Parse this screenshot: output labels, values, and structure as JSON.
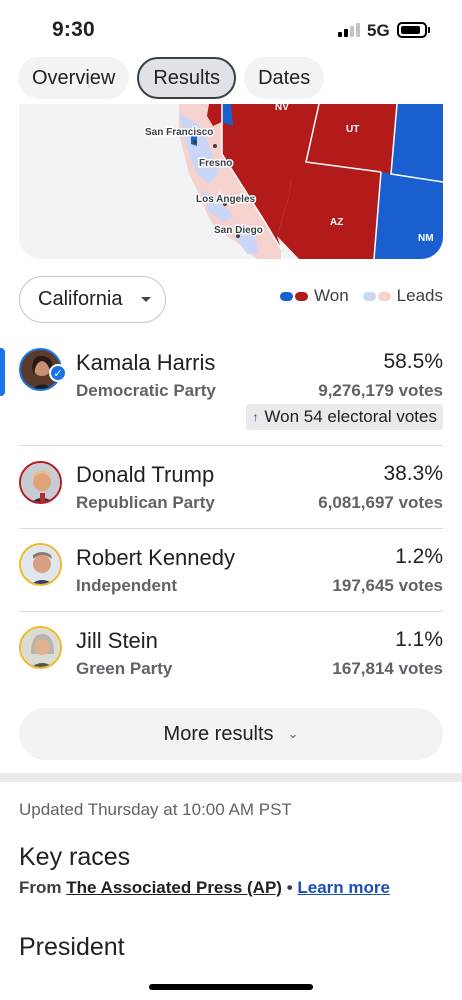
{
  "status": {
    "time": "9:30",
    "network": "5G"
  },
  "tabs": [
    {
      "label": "Overview",
      "active": false
    },
    {
      "label": "Results",
      "active": true
    },
    {
      "label": "Dates",
      "active": false
    }
  ],
  "map": {
    "cities": [
      "San Francisco",
      "Fresno",
      "Los Angeles",
      "San Diego"
    ],
    "states": [
      "NV",
      "UT",
      "AZ",
      "NM"
    ]
  },
  "selector": {
    "state": "California"
  },
  "legend": {
    "won": "Won",
    "leads": "Leads"
  },
  "colors": {
    "dem": "#1a5fd0",
    "rep": "#b31b1b",
    "dem_light": "#cbd6f7",
    "rep_light": "#f6d2cf",
    "accent": "#1a73e8"
  },
  "candidates": [
    {
      "name": "Kamala Harris",
      "party": "Democratic Party",
      "pct": "58.5%",
      "votes": "9,276,179 votes",
      "badge": "Won 54 electoral votes",
      "winner": true
    },
    {
      "name": "Donald Trump",
      "party": "Republican Party",
      "pct": "38.3%",
      "votes": "6,081,697 votes"
    },
    {
      "name": "Robert Kennedy",
      "party": "Independent",
      "pct": "1.2%",
      "votes": "197,645 votes"
    },
    {
      "name": "Jill Stein",
      "party": "Green Party",
      "pct": "1.1%",
      "votes": "167,814 votes"
    }
  ],
  "more_results": "More results",
  "updated": "Updated Thursday at 10:00 AM PST",
  "key_races": {
    "title": "Key races",
    "from": "From",
    "source": "The Associated Press (AP)",
    "separator": "•",
    "learn_more": "Learn more"
  },
  "president_heading": "President"
}
